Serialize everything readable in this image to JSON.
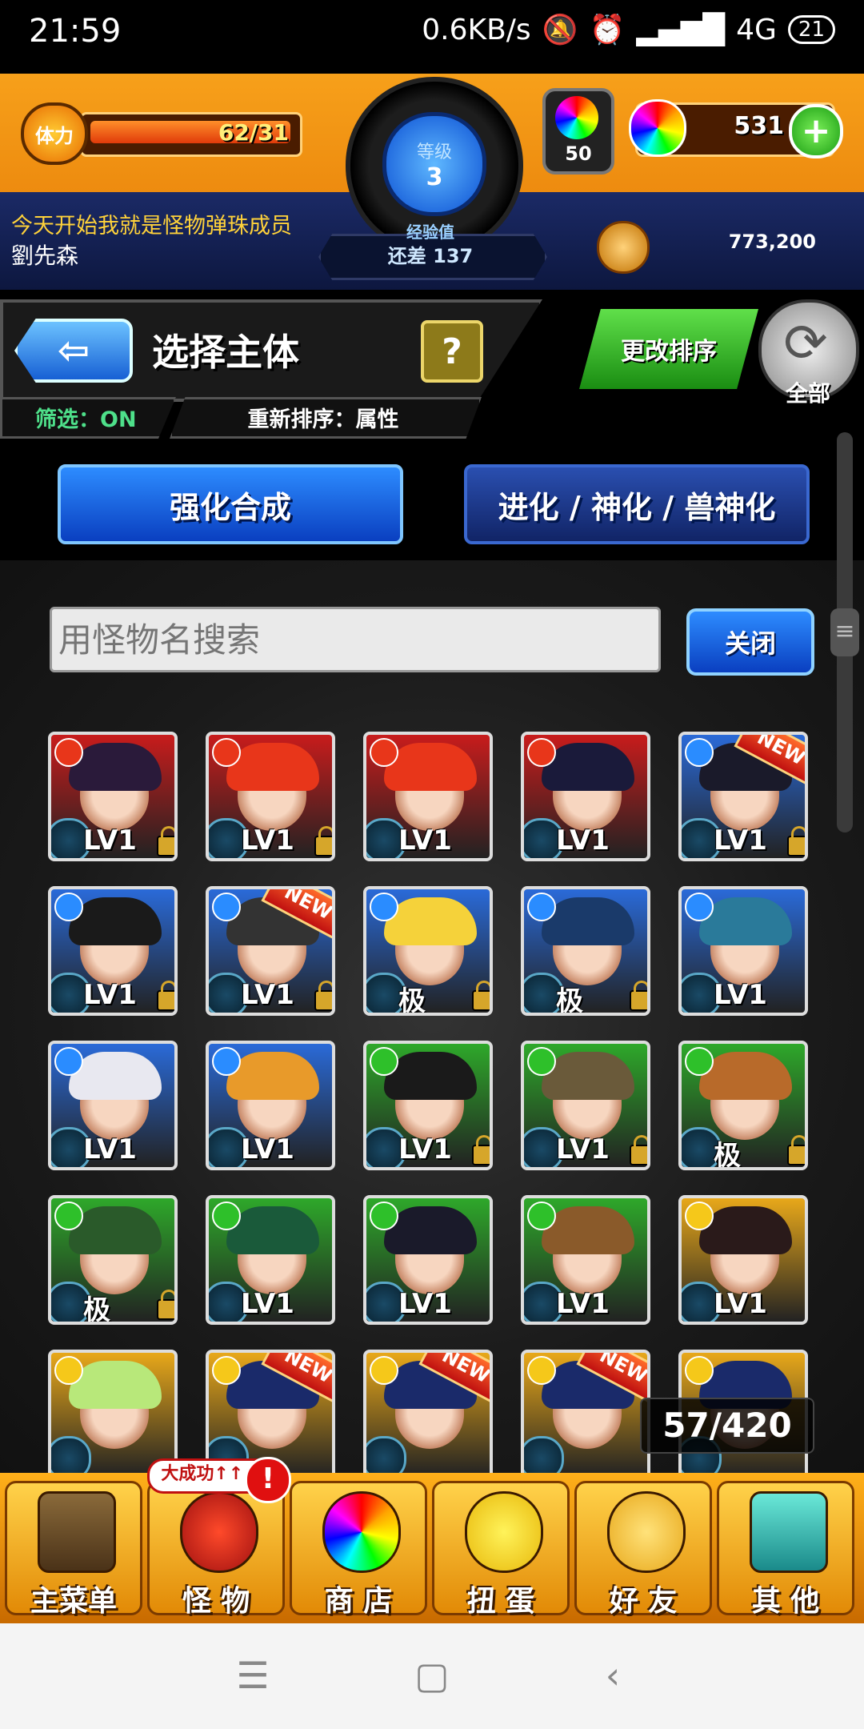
{
  "status_bar": {
    "time": "21:59",
    "net_speed": "0.6KB/s",
    "network": "4G",
    "battery": "21"
  },
  "header": {
    "stamina_label": "体力",
    "stamina_value": "62/31",
    "level_label": "等级",
    "level_value": "3",
    "exp_label": "经验值",
    "exp_remaining": "还差 137",
    "orb_count": "50",
    "gem_count": "531",
    "motto": "今天开始我就是怪物弹珠成员",
    "player_name": "劉先森",
    "coins": "773,200"
  },
  "toolbar": {
    "page_title": "选择主体",
    "help_label": "?",
    "filter_label": "筛选：ON",
    "sort_label": "重新排序：属性",
    "change_sort_label": "更改排序",
    "refresh_label": "全部"
  },
  "tabs": [
    {
      "label": "强化合成",
      "active": true
    },
    {
      "label": "进化 / 神化 / 兽神化",
      "active": false
    }
  ],
  "search": {
    "placeholder": "用怪物名搜索",
    "close_label": "关闭"
  },
  "monsters": [
    {
      "label": "LV1",
      "attr": "fire",
      "hair": "#2a1a3a",
      "bg": "#c81c1c",
      "locked": true,
      "new": false
    },
    {
      "label": "LV1",
      "attr": "fire",
      "hair": "#e8361a",
      "bg": "#c81c1c",
      "locked": true,
      "new": false
    },
    {
      "label": "LV1",
      "attr": "fire",
      "hair": "#e8361a",
      "bg": "#c81c1c",
      "locked": false,
      "new": false
    },
    {
      "label": "LV1",
      "attr": "fire",
      "hair": "#1a1a3a",
      "bg": "#c81c1c",
      "locked": false,
      "new": false
    },
    {
      "label": "LV1",
      "attr": "water",
      "hair": "#1a1a2a",
      "bg": "#2a6ad8",
      "locked": true,
      "new": true
    },
    {
      "label": "LV1",
      "attr": "water",
      "hair": "#1a1a1a",
      "bg": "#2a6ad8",
      "locked": true,
      "new": false
    },
    {
      "label": "LV1",
      "attr": "water",
      "hair": "#333333",
      "bg": "#2a6ad8",
      "locked": true,
      "new": true
    },
    {
      "label": "极",
      "attr": "water",
      "hair": "#f5d23a",
      "bg": "#2a6ad8",
      "locked": true,
      "new": false
    },
    {
      "label": "极",
      "attr": "water",
      "hair": "#1a3a6a",
      "bg": "#2a6ad8",
      "locked": true,
      "new": false
    },
    {
      "label": "LV1",
      "attr": "water",
      "hair": "#2a7a9a",
      "bg": "#2a6ad8",
      "locked": false,
      "new": false
    },
    {
      "label": "LV1",
      "attr": "water",
      "hair": "#e8e8f0",
      "bg": "#2a6ad8",
      "locked": false,
      "new": false
    },
    {
      "label": "LV1",
      "attr": "water",
      "hair": "#e89a2a",
      "bg": "#2a6ad8",
      "locked": false,
      "new": false
    },
    {
      "label": "LV1",
      "attr": "wood",
      "hair": "#1a1a1a",
      "bg": "#2ea82a",
      "locked": true,
      "new": false
    },
    {
      "label": "LV1",
      "attr": "wood",
      "hair": "#6a5a3a",
      "bg": "#2ea82a",
      "locked": true,
      "new": false
    },
    {
      "label": "极",
      "attr": "wood",
      "hair": "#b86a2a",
      "bg": "#2ea82a",
      "locked": true,
      "new": false
    },
    {
      "label": "极",
      "attr": "wood",
      "hair": "#2a5a2a",
      "bg": "#2ea82a",
      "locked": true,
      "new": false
    },
    {
      "label": "LV1",
      "attr": "wood",
      "hair": "#1a5a3a",
      "bg": "#2ea82a",
      "locked": false,
      "new": false
    },
    {
      "label": "LV1",
      "attr": "wood",
      "hair": "#1a1a2a",
      "bg": "#2ea82a",
      "locked": false,
      "new": false
    },
    {
      "label": "LV1",
      "attr": "wood",
      "hair": "#8a5a2a",
      "bg": "#2ea82a",
      "locked": false,
      "new": false
    },
    {
      "label": "LV1",
      "attr": "light",
      "hair": "#2a1a1a",
      "bg": "#e8a81a",
      "locked": false,
      "new": false
    },
    {
      "label": "",
      "attr": "light",
      "hair": "#b8e87a",
      "bg": "#e8a81a",
      "locked": false,
      "new": false
    },
    {
      "label": "",
      "attr": "light",
      "hair": "#1a2a6a",
      "bg": "#e8a81a",
      "locked": false,
      "new": true
    },
    {
      "label": "",
      "attr": "light",
      "hair": "#1a2a6a",
      "bg": "#e8a81a",
      "locked": false,
      "new": true
    },
    {
      "label": "",
      "attr": "light",
      "hair": "#1a2a6a",
      "bg": "#e8a81a",
      "locked": false,
      "new": true
    },
    {
      "label": "",
      "attr": "light",
      "hair": "#1a2a6a",
      "bg": "#e8a81a",
      "locked": false,
      "new": false
    }
  ],
  "new_label": "NEW",
  "monster_count": "57/420",
  "bottom_nav": {
    "items": [
      {
        "label": "主菜单",
        "icon": "gate-icon"
      },
      {
        "label": "怪 物",
        "icon": "monster-icon"
      },
      {
        "label": "商 店",
        "icon": "orb-icon"
      },
      {
        "label": "扭 蛋",
        "icon": "egg-icon"
      },
      {
        "label": "好 友",
        "icon": "friends-icon"
      },
      {
        "label": "其 他",
        "icon": "question-icon"
      }
    ],
    "monster_badge": "大成功↑↑↑",
    "alert": "!"
  },
  "colors": {
    "header_orange": "#f39a14",
    "tab_active": "#2d8cff",
    "sort_green": "#3cc02a"
  }
}
